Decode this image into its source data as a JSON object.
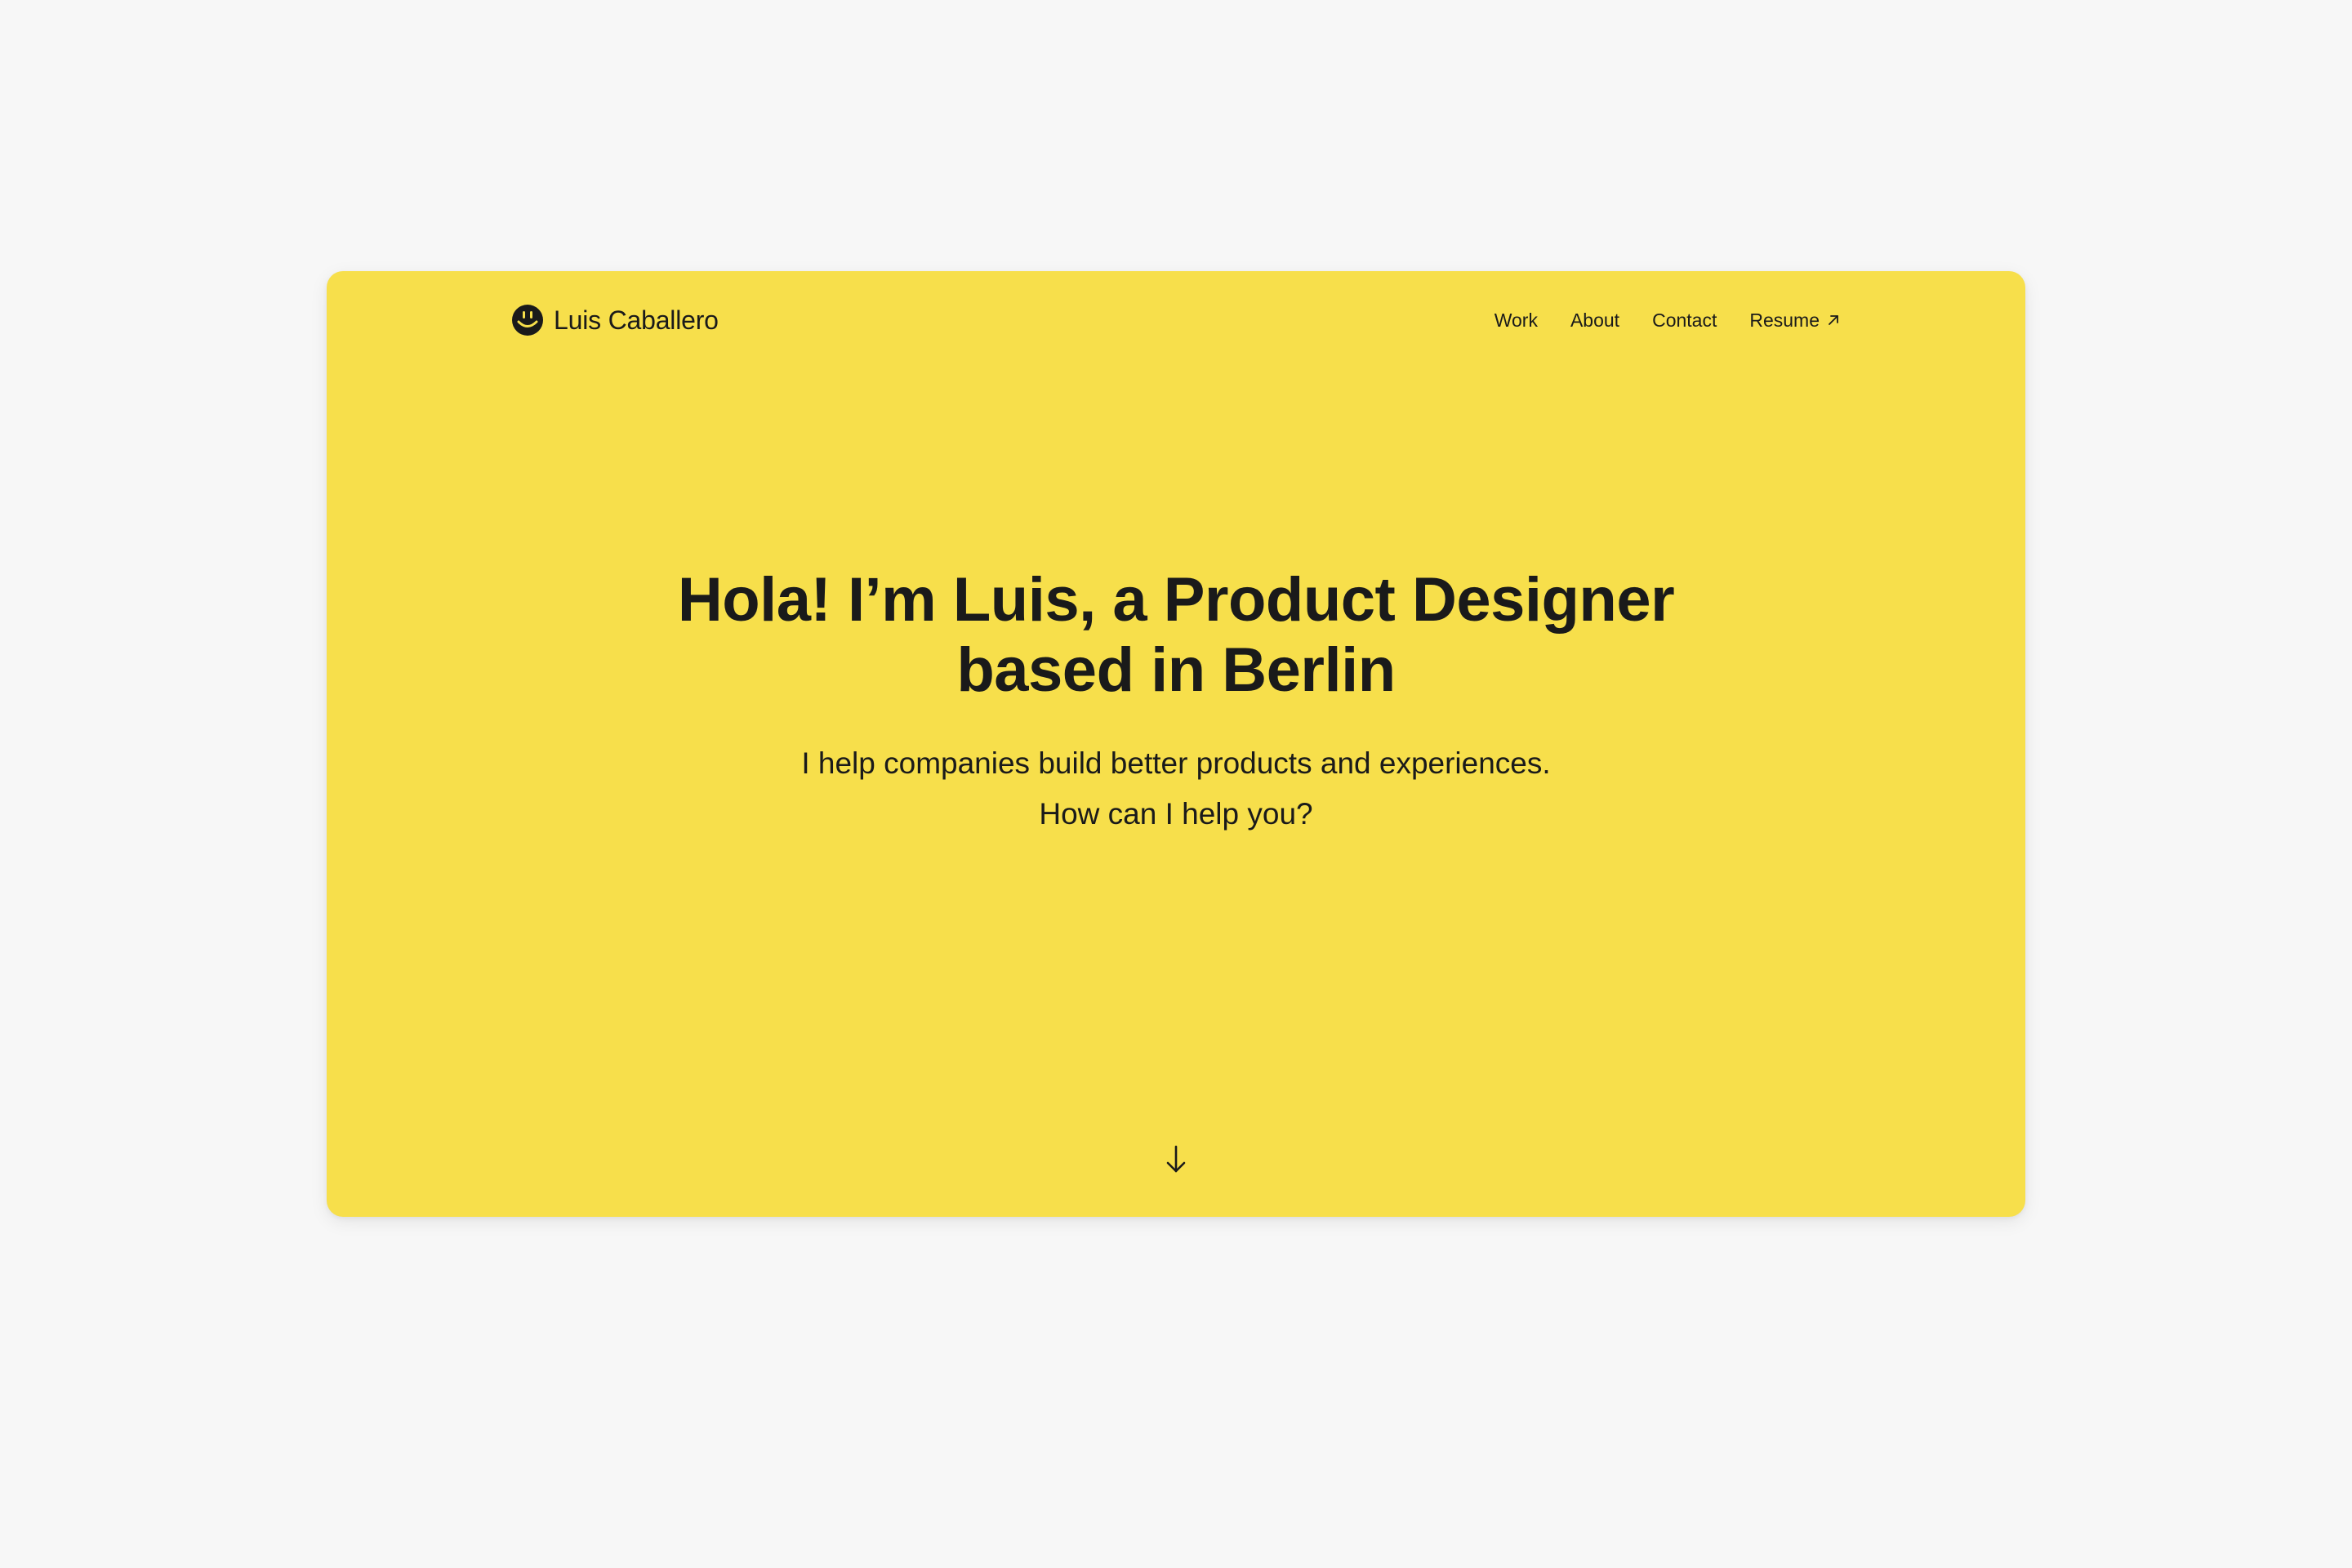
{
  "header": {
    "brand_name": "Luis Caballero",
    "brand_icon": "smiley-face-icon",
    "nav": [
      {
        "label": "Work"
      },
      {
        "label": "About"
      },
      {
        "label": "Contact"
      },
      {
        "label": "Resume",
        "icon": "arrow-up-right-icon"
      }
    ]
  },
  "hero": {
    "title_line1": "Hola! I’m Luis, a Product Designer",
    "title_line2": "based in Berlin",
    "subtitle_line1": "I help companies build better products and experiences.",
    "subtitle_line2": "How can I help you?"
  },
  "scroll": {
    "icon": "arrow-down-icon"
  },
  "colors": {
    "page_background": "#f7f7f7",
    "card_background": "#f7df4b",
    "text": "#1a1a1a"
  }
}
